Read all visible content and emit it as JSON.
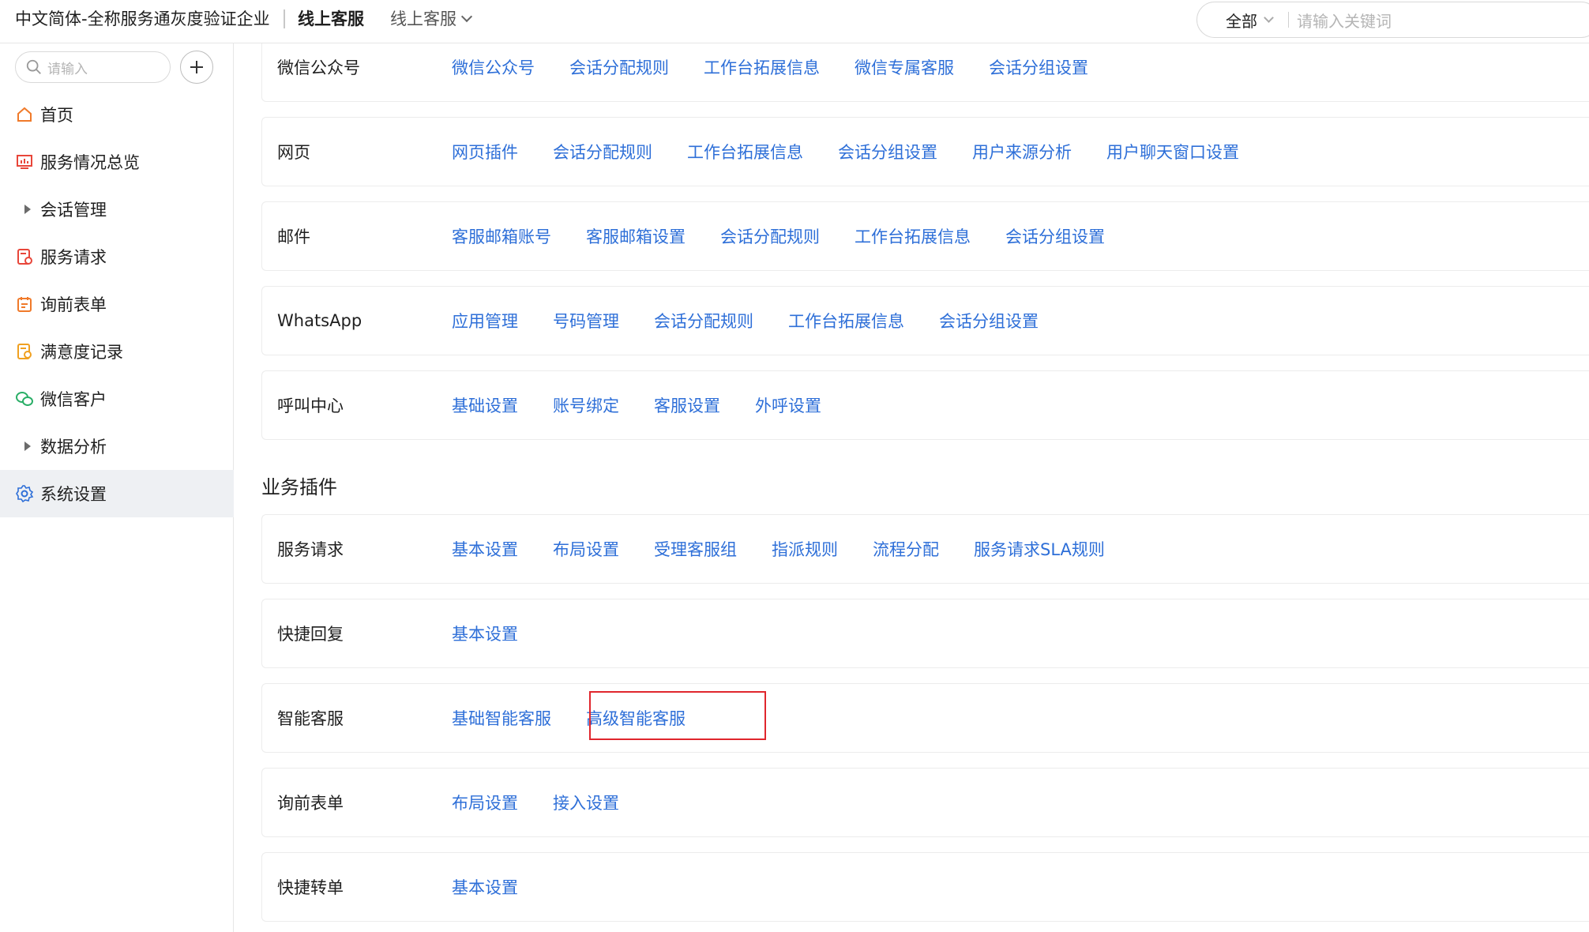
{
  "header": {
    "org_name": "中文简体-全称服务通灰度验证企业",
    "product_name": "线上客服",
    "switcher_label": "线上客服",
    "search_scope": "全部",
    "search_placeholder": "请输入关键词"
  },
  "sidebar": {
    "search_placeholder": "请输入",
    "items": [
      {
        "label": "首页",
        "icon": "home-icon"
      },
      {
        "label": "服务情况总览",
        "icon": "dashboard-icon"
      },
      {
        "label": "会话管理",
        "icon": "expand-arrow-icon"
      },
      {
        "label": "服务请求",
        "icon": "service-request-icon"
      },
      {
        "label": "询前表单",
        "icon": "form-icon"
      },
      {
        "label": "满意度记录",
        "icon": "satisfaction-icon"
      },
      {
        "label": "微信客户",
        "icon": "wechat-icon"
      },
      {
        "label": "数据分析",
        "icon": "expand-arrow-icon"
      },
      {
        "label": "系统设置",
        "icon": "gear-icon",
        "active": true
      }
    ]
  },
  "channels": [
    {
      "label": "微信公众号",
      "links": [
        "微信公众号",
        "会话分配规则",
        "工作台拓展信息",
        "微信专属客服",
        "会话分组设置"
      ]
    },
    {
      "label": "网页",
      "links": [
        "网页插件",
        "会话分配规则",
        "工作台拓展信息",
        "会话分组设置",
        "用户来源分析",
        "用户聊天窗口设置"
      ]
    },
    {
      "label": "邮件",
      "links": [
        "客服邮箱账号",
        "客服邮箱设置",
        "会话分配规则",
        "工作台拓展信息",
        "会话分组设置"
      ]
    },
    {
      "label": "WhatsApp",
      "links": [
        "应用管理",
        "号码管理",
        "会话分配规则",
        "工作台拓展信息",
        "会话分组设置"
      ]
    },
    {
      "label": "呼叫中心",
      "links": [
        "基础设置",
        "账号绑定",
        "客服设置",
        "外呼设置"
      ]
    }
  ],
  "plugins_section_title": "业务插件",
  "plugins": [
    {
      "label": "服务请求",
      "links": [
        "基本设置",
        "布局设置",
        "受理客服组",
        "指派规则",
        "流程分配",
        "服务请求SLA规则"
      ]
    },
    {
      "label": "快捷回复",
      "links": [
        "基本设置"
      ]
    },
    {
      "label": "智能客服",
      "links": [
        "基础智能客服",
        "高级智能客服"
      ]
    },
    {
      "label": "询前表单",
      "links": [
        "布局设置",
        "接入设置"
      ]
    },
    {
      "label": "快捷转单",
      "links": [
        "基本设置"
      ]
    }
  ],
  "colors": {
    "link": "#2e6fd8",
    "highlight": "#e0262d",
    "active_bg": "#eef0f3"
  }
}
